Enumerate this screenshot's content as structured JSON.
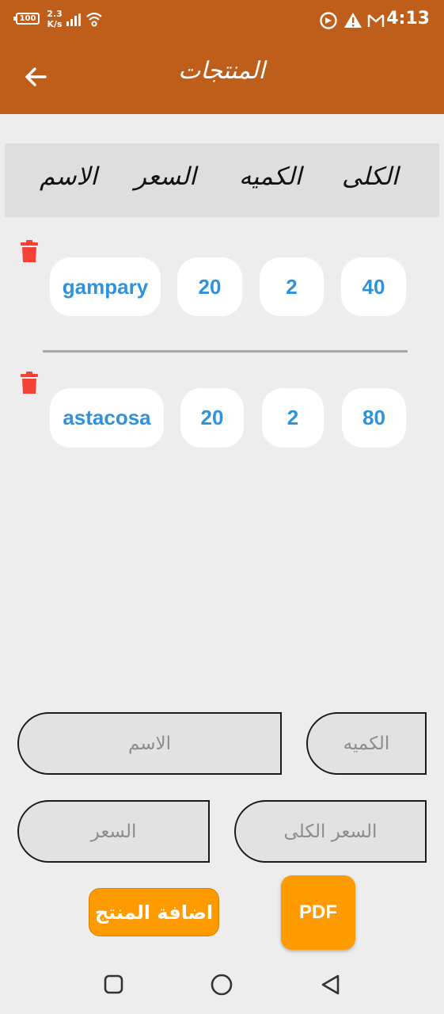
{
  "status_bar": {
    "battery": "100",
    "net_speed_value": "2.3",
    "net_speed_unit": "K/s",
    "time": "4:13",
    "icons": [
      "battery-icon",
      "signal-icon",
      "wifi-icon",
      "sync-icon",
      "warning-icon",
      "gmail-icon"
    ]
  },
  "app_bar": {
    "title": "المنتجات",
    "back_icon": "arrow-left-icon",
    "color": "#bf5e1b"
  },
  "table": {
    "headers": {
      "total": "الكلى",
      "quantity": "الكميه",
      "price": "السعر",
      "name": "الاسم"
    },
    "rows": [
      {
        "name": "gampary",
        "price": "20",
        "quantity": "2",
        "total": "40"
      },
      {
        "name": "astacosa",
        "price": "20",
        "quantity": "2",
        "total": "80"
      }
    ],
    "delete_icon": "trash-icon",
    "delete_color": "#f44336",
    "value_color": "#2f92db"
  },
  "form": {
    "name_placeholder": "الاسم",
    "quantity_placeholder": "الكميه",
    "price_placeholder": "السعر",
    "total_price_placeholder": "السعر الكلى"
  },
  "buttons": {
    "add_product": "اضافة المنتج",
    "pdf": "PDF",
    "accent": "#ff9a00"
  },
  "nav_bar": {
    "icons": [
      "recent-apps-icon",
      "home-icon",
      "back-icon"
    ]
  }
}
